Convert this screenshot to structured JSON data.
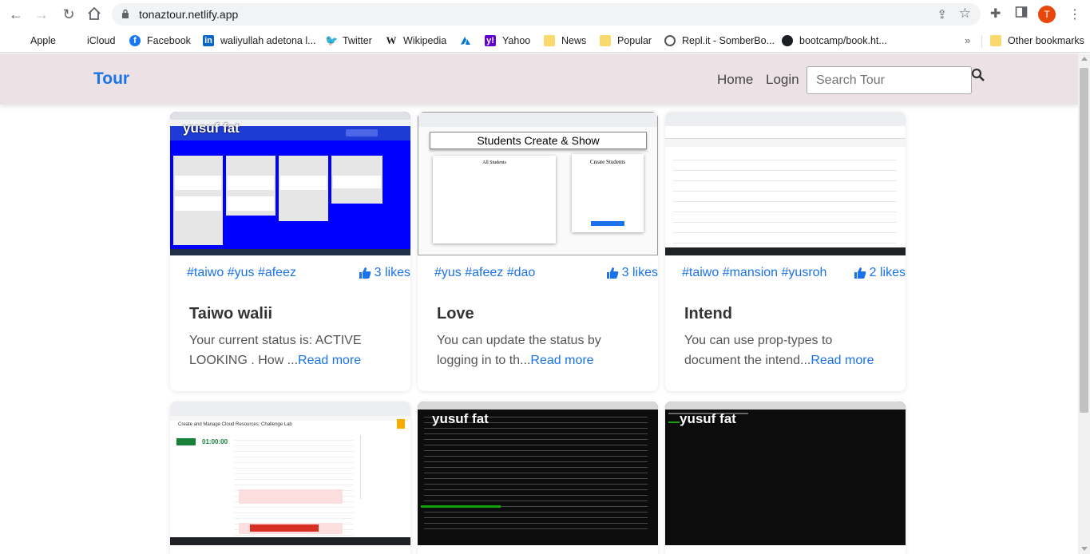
{
  "browser": {
    "url": "tonaztour.netlify.app",
    "profile_initial": "T"
  },
  "bookmarks": [
    {
      "label": "Apple",
      "icon": "apple-icon"
    },
    {
      "label": "iCloud",
      "icon": "apple-icon"
    },
    {
      "label": "Facebook",
      "icon": "facebook-icon"
    },
    {
      "label": "waliyullah adetona l...",
      "icon": "linkedin-icon"
    },
    {
      "label": "Twitter",
      "icon": "twitter-icon"
    },
    {
      "label": "Wikipedia",
      "icon": "wikipedia-icon"
    },
    {
      "label": "",
      "icon": "azure-icon"
    },
    {
      "label": "Yahoo",
      "icon": "yahoo-icon"
    },
    {
      "label": "News",
      "icon": "folder-icon"
    },
    {
      "label": "Popular",
      "icon": "folder-icon"
    },
    {
      "label": "Repl.it - SomberBo...",
      "icon": "replit-icon"
    },
    {
      "label": "bootcamp/book.ht...",
      "icon": "github-icon"
    }
  ],
  "bookmarks_more": "»",
  "other_bookmarks": "Other bookmarks",
  "navbar": {
    "brand": "Tour",
    "links": [
      "Home",
      "Login"
    ],
    "search_placeholder": "Search Tour"
  },
  "cards": [
    {
      "tags": "#taiwo #yus #afeez",
      "likes": "3 likes",
      "title": "Taiwo walii",
      "desc": "Your current status is: ACTIVE LOOKING . How ...",
      "read_more": "Read more",
      "thumb_label": "yusuf fat",
      "thumb_kind": "trello"
    },
    {
      "tags": "#yus #afeez #dao",
      "likes": "3 likes",
      "title": "Love",
      "desc": "You can update the status by logging in to th...",
      "read_more": "Read more",
      "thumb_label": "",
      "thumb_kind": "students",
      "thumb_heading": "Students Create & Show",
      "thumb_panel_left": "All Students",
      "thumb_panel_right": "Create Students"
    },
    {
      "tags": "#taiwo #mansion #yusroh",
      "likes": "2 likes",
      "title": "Intend",
      "desc": "You can use prop-types to document the intend...",
      "read_more": "Read more",
      "thumb_label": "",
      "thumb_kind": "table"
    },
    {
      "thumb_kind": "lab",
      "thumb_label": "",
      "thumb_heading": "Create and Manage Cloud Resources: Challenge Lab",
      "thumb_timer": "01:00:00"
    },
    {
      "thumb_kind": "terminal",
      "thumb_label": "yusuf fat"
    },
    {
      "thumb_kind": "terminal-blank",
      "thumb_label": "yusuf fat"
    }
  ],
  "colors": {
    "accent": "#1a73e8",
    "navbar_bg": "#ece2e6",
    "trello_blue": "#0000ff"
  }
}
